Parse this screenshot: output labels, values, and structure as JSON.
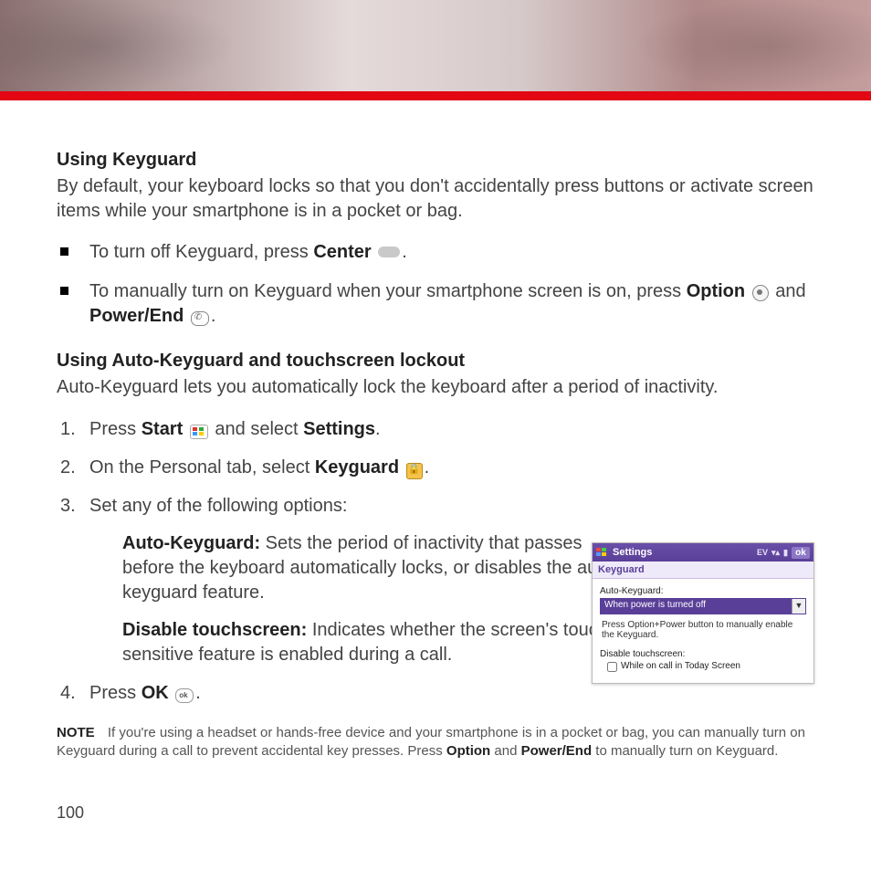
{
  "section1": {
    "title": "Using Keyguard",
    "intro": "By default, your keyboard locks so that you don't accidentally press buttons or activate screen items while your smartphone is in a pocket or bag.",
    "bullet1_a": "To turn off Keyguard, press ",
    "bullet1_key": "Center",
    "bullet1_c": ".",
    "bullet2_a": "To manually turn on Keyguard when your smartphone screen is on, press ",
    "bullet2_key1": "Option",
    "bullet2_b": " and ",
    "bullet2_key2": "Power/End",
    "bullet2_c": "."
  },
  "section2": {
    "title": "Using Auto-Keyguard and touchscreen lockout",
    "intro": "Auto-Keyguard lets you automatically lock the keyboard after a period of inactivity.",
    "step1_a": "Press ",
    "step1_key": "Start",
    "step1_b": " and select ",
    "step1_key2": "Settings",
    "step1_c": ".",
    "step2_a": "On the Personal tab, select ",
    "step2_key": "Keyguard",
    "step2_b": ".",
    "step3": "Set any of the following options:",
    "opt1_label": "Auto-Keyguard:",
    "opt1_text": " Sets the period of inactivity that passes before the keyboard automatically locks, or disables the auto-keyguard feature.",
    "opt2_label": "Disable touchscreen:",
    "opt2_text": " Indicates whether the screen's touch-sensitive feature is enabled during a call.",
    "step4_a": "Press ",
    "step4_key": "OK",
    "step4_b": "."
  },
  "note": {
    "label": "NOTE",
    "t1": "If you're using a headset or hands-free device and your smartphone is in a pocket or bag, you can manually turn on Keyguard during a call to prevent accidental key presses. Press ",
    "k1": "Option",
    "t2": " and ",
    "k2": "Power/End",
    "t3": " to manually turn on Keyguard."
  },
  "page_number": "100",
  "dialog": {
    "title": "Settings",
    "ok": "ok",
    "status_ev": "EV",
    "header": "Keyguard",
    "label_auto": "Auto-Keyguard:",
    "select_value": "When power is turned off",
    "hint": "Press Option+Power button to manually enable the Keyguard.",
    "label_disable": "Disable touchscreen:",
    "checkbox_label": "While on call in Today Screen"
  }
}
